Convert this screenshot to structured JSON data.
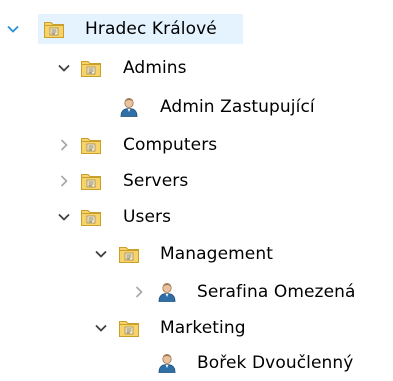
{
  "tree": {
    "nodes": [
      {
        "label": "Hradec Králové",
        "type": "ou",
        "state": "expanded",
        "depth": 0,
        "selected": true,
        "twisty_color": "#2b8fd6"
      },
      {
        "label": "Admins",
        "type": "ou",
        "state": "expanded",
        "depth": 1
      },
      {
        "label": "Admin Zastupující",
        "type": "user",
        "state": "leaf",
        "depth": 2
      },
      {
        "label": "Computers",
        "type": "ou",
        "state": "collapsed",
        "depth": 1
      },
      {
        "label": "Servers",
        "type": "ou",
        "state": "collapsed",
        "depth": 1
      },
      {
        "label": "Users",
        "type": "ou",
        "state": "expanded",
        "depth": 1
      },
      {
        "label": "Management",
        "type": "ou",
        "state": "expanded",
        "depth": 2
      },
      {
        "label": "Serafina Omezená",
        "type": "user",
        "state": "collapsed",
        "depth": 3
      },
      {
        "label": "Marketing",
        "type": "ou",
        "state": "expanded",
        "depth": 2
      },
      {
        "label": "Bořek Dvoučlenný",
        "type": "user",
        "state": "leaf",
        "depth": 3
      }
    ],
    "icons": {
      "ou": "folder-ou-icon",
      "user": "user-icon",
      "expanded": "chevron-down-icon",
      "collapsed": "chevron-right-icon"
    },
    "colors": {
      "selection": "#e5f3ff",
      "chevron_expanded": "#404040",
      "chevron_collapsed": "#a6a6a6",
      "folder_body": "#f7d36a",
      "folder_edge": "#c9a02c",
      "user_head": "#e8c39e",
      "user_body": "#2f6fa8"
    }
  }
}
